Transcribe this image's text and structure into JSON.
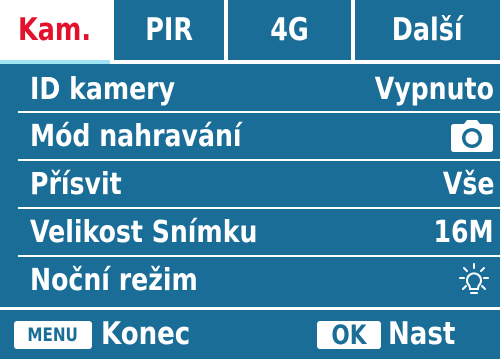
{
  "colors": {
    "panel_blue": "#1a6d96",
    "active_tab_text": "#e3122c",
    "tab_indicator": "#9fe4f2",
    "text": "#ffffff"
  },
  "tabs": [
    {
      "label": "Kam.",
      "active": true
    },
    {
      "label": "PIR",
      "active": false
    },
    {
      "label": "4G",
      "active": false
    },
    {
      "label": "Další",
      "active": false
    }
  ],
  "settings": [
    {
      "label": "ID kamery",
      "value": "Vypnuto"
    },
    {
      "label": "Mód nahravání",
      "value_icon": "camera-icon"
    },
    {
      "label": "Přísvit",
      "value": "Vše"
    },
    {
      "label": "Velikost Snímku",
      "value": "16M"
    },
    {
      "label": "Noční režim",
      "value_icon": "sun-icon"
    }
  ],
  "footer": {
    "menu_key": "MENU",
    "menu_action": "Konec",
    "ok_key": "OK",
    "ok_action": "Nast"
  }
}
